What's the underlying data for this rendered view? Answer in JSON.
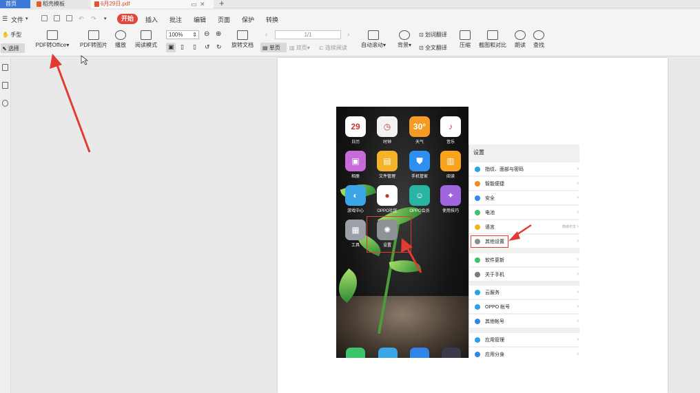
{
  "tabs": [
    {
      "label": "首页"
    },
    {
      "label": "稻壳模板"
    },
    {
      "label": "6月29日.pdf"
    }
  ],
  "menu": {
    "file": "文件",
    "items": [
      "开始",
      "插入",
      "批注",
      "编辑",
      "页面",
      "保护",
      "转换"
    ]
  },
  "toolbar": {
    "hand": "手型",
    "select": "选择",
    "pdf_to_office": "PDF转Office",
    "pdf_to_image": "PDF转图片",
    "play": "播放",
    "read_mode": "阅读模式",
    "zoom": "100%",
    "rotate": "旋转文档",
    "single_page": "单页",
    "double_page": "双页",
    "continuous": "连续阅读",
    "page_indicator": "1/1",
    "auto_scroll": "自动滚动",
    "background": "背景",
    "translate_word": "划词翻译",
    "translate_full": "全文翻译",
    "compress": "压缩",
    "screenshot_compare": "截图和对比",
    "read_aloud": "朗读",
    "find": "查找"
  },
  "phone": {
    "apps": [
      {
        "label": "日历",
        "glyph": "29",
        "color": "#ffffff"
      },
      {
        "label": "时钟",
        "glyph": "◷",
        "color": "#f2f2f2"
      },
      {
        "label": "天气",
        "glyph": "30°",
        "color": "#f59a23"
      },
      {
        "label": "音乐",
        "glyph": "♪",
        "color": "#ffffff"
      },
      {
        "label": "相册",
        "glyph": "▣",
        "color": "#c86bd8"
      },
      {
        "label": "文件管理",
        "glyph": "▤",
        "color": "#f4b32a"
      },
      {
        "label": "手机管家",
        "glyph": "⛊",
        "color": "#2f8ff0"
      },
      {
        "label": "阅读",
        "glyph": "▥",
        "color": "#f7a31c"
      },
      {
        "label": "游戏中心",
        "glyph": "◐",
        "color": "#3aa6e8"
      },
      {
        "label": "OPPO社区",
        "glyph": "●",
        "color": "#ffffff"
      },
      {
        "label": "OPPO会员",
        "glyph": "☺",
        "color": "#29b3a3"
      },
      {
        "label": "使用技巧",
        "glyph": "✦",
        "color": "#a066e0"
      },
      {
        "label": "工具",
        "glyph": "▦",
        "color": "#9aa0a6"
      },
      {
        "label": "设置",
        "glyph": "✺",
        "color": "#8e9196"
      }
    ]
  },
  "settings": {
    "title": "设置",
    "rows": [
      {
        "label": "指纹、面部与密码",
        "value": "",
        "color": "#2aa3e6"
      },
      {
        "label": "智能便捷",
        "value": "",
        "color": "#f08a1e"
      },
      {
        "label": "安全",
        "value": "",
        "color": "#2f86e8"
      },
      {
        "label": "电池",
        "value": "",
        "color": "#3cc46a"
      },
      {
        "label": "语言",
        "value": "简体中文",
        "color": "#f0b81e"
      },
      {
        "label": "其他设置",
        "value": "",
        "color": "#8c8c8c"
      },
      {
        "label": "软件更新",
        "value": "",
        "color": "#3cc46a"
      },
      {
        "label": "关于手机",
        "value": "",
        "color": "#7a7a7a"
      },
      {
        "label": "云服务",
        "value": "",
        "color": "#2aa3e6"
      },
      {
        "label": "OPPO 帐号",
        "value": "",
        "color": "#2aa3e6"
      },
      {
        "label": "其他帐号",
        "value": "",
        "color": "#2f86e8"
      },
      {
        "label": "应用管理",
        "value": "",
        "color": "#2aa3e6"
      },
      {
        "label": "应用分身",
        "value": "",
        "color": "#2f86e8"
      }
    ]
  },
  "colors": {
    "accent": "#e2473d",
    "tab_active": "#3c78d8",
    "annotation": "#e23b34"
  }
}
